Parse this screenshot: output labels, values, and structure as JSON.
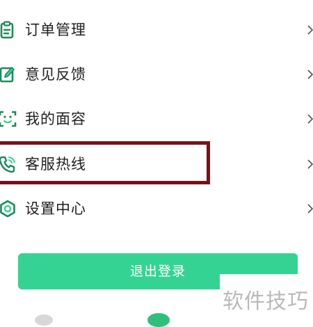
{
  "menu": {
    "items": [
      {
        "label": "订单管理",
        "icon": "clipboard-icon"
      },
      {
        "label": "意见反馈",
        "icon": "edit-icon"
      },
      {
        "label": "我的面容",
        "icon": "face-scan-icon"
      },
      {
        "label": "客服热线",
        "icon": "phone-icon"
      },
      {
        "label": "设置中心",
        "icon": "settings-icon"
      }
    ]
  },
  "logout": {
    "label": "退出登录"
  },
  "watermark": {
    "text": "软件技巧"
  },
  "colors": {
    "accent": "#35d393",
    "icon": "#1c8a5a",
    "highlight_border": "#7a1016"
  }
}
